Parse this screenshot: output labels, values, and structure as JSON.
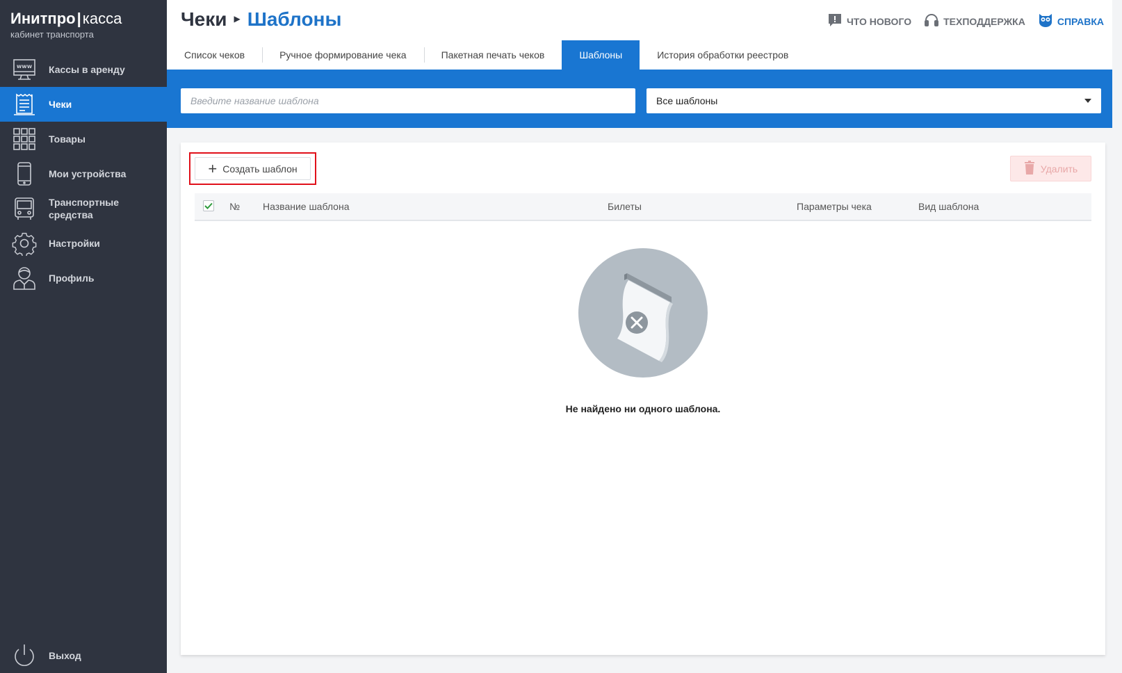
{
  "brand": {
    "name_bold": "Инитпро",
    "separator": "|",
    "name_light": "касса",
    "subtitle": "кабинет транспорта"
  },
  "sidebar": {
    "items": [
      {
        "label": "Кассы в аренду",
        "icon": "terminal-www-icon",
        "active": false
      },
      {
        "label": "Чеки",
        "icon": "receipt-icon",
        "active": true
      },
      {
        "label": "Товары",
        "icon": "grid-icon",
        "active": false
      },
      {
        "label": "Мои устройства",
        "icon": "smartphone-icon",
        "active": false
      },
      {
        "label": "Транспортные средства",
        "label_line1": "Транспортные",
        "label_line2": "средства",
        "icon": "bus-icon",
        "active": false
      },
      {
        "label": "Настройки",
        "icon": "gear-icon",
        "active": false
      },
      {
        "label": "Профиль",
        "icon": "user-icon",
        "active": false
      }
    ],
    "exit_label": "Выход"
  },
  "header": {
    "breadcrumb_root": "Чеки",
    "breadcrumb_current": "Шаблоны",
    "links": {
      "whats_new": "ЧТО НОВОГО",
      "support": "ТЕХПОДДЕРЖКА",
      "help": "СПРАВКА"
    }
  },
  "tabs": [
    {
      "label": "Список чеков",
      "active": false
    },
    {
      "label": "Ручное формирование чека",
      "active": false
    },
    {
      "label": "Пакетная печать чеков",
      "active": false
    },
    {
      "label": "Шаблоны",
      "active": true
    },
    {
      "label": "История обработки реестров",
      "active": false
    }
  ],
  "filters": {
    "search_placeholder": "Введите название шаблона",
    "search_value": "",
    "template_select_value": "Все шаблоны"
  },
  "actions": {
    "create_label": "Создать шаблон",
    "delete_label": "Удалить"
  },
  "table": {
    "columns": {
      "number": "№",
      "name": "Название шаблона",
      "tickets": "Билеты",
      "params": "Параметры чека",
      "type": "Вид шаблона"
    },
    "select_all_checked": true
  },
  "empty_state": {
    "message": "Не найдено ни одного шаблона."
  },
  "colors": {
    "sidebar_bg": "#2f3440",
    "accent": "#1976d2",
    "breadcrumb_current": "#1e73c8",
    "highlight_frame": "#e0101a"
  }
}
